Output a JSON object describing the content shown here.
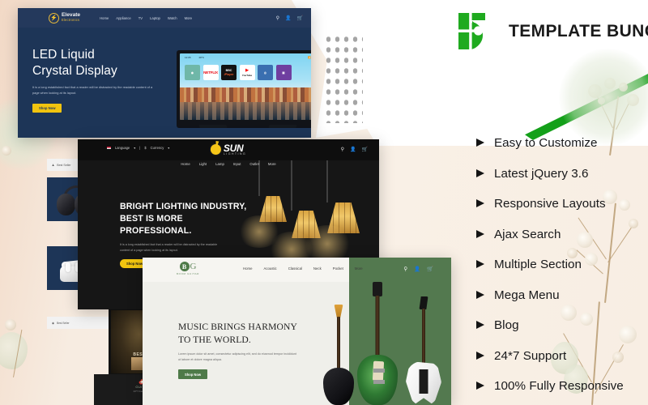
{
  "brand": {
    "name": "TEMPLATE BUNCH",
    "logo_icon": "template-bunch-b-logo",
    "accent_green": "#14a01a",
    "bg_cream": "#f7ece0"
  },
  "features": {
    "bullet_icon": "triangle-right-arrow-icon",
    "items": [
      "Easy to Customize",
      "Latest jQuery 3.6",
      "Responsive Layouts",
      "Ajax Search",
      "Multiple Section",
      "Mega Menu",
      "Blog",
      "24*7 Support",
      "100% Fully Responsive"
    ]
  },
  "mockup_electronics": {
    "logo_line1": "Elevate",
    "logo_line2": "Electronics",
    "logo_icon": "lightning-bolt-badge-icon",
    "menu": [
      "Home",
      "Appliance",
      "TV",
      "Laptop",
      "Watch",
      "More"
    ],
    "icons": [
      "search-icon",
      "account-icon",
      "cart-icon"
    ],
    "heading": "LED Liquid\nCrystal Display",
    "paragraph": "It is a long established fact that a reader will be distracted by the readable content of a page when looking at its layout.",
    "button": "Shop Now",
    "tv": {
      "weather": "28°C",
      "tiles": [
        "app",
        "NETFLIX",
        "BBC iPlayer",
        "YouTube",
        "app",
        "app"
      ]
    }
  },
  "mockup_lighting": {
    "language": "Language",
    "currency": "Currency",
    "logo_main": "SUN",
    "logo_sub": "LIGHTING",
    "logo_icon": "sun-icon",
    "menu": [
      "Home",
      "Light",
      "Lamp",
      "Input",
      "Outlet",
      "More"
    ],
    "icons": [
      "search-icon",
      "account-icon",
      "cart-icon"
    ],
    "heading_line1": "BRIGHT LIGHTING INDUSTRY,",
    "heading_line2": "BEST IS MORE PROFESSIONAL.",
    "paragraph": "It is a long established fact that a reader will be distracted by the readable content of a page when looking at its layout.",
    "button": "Shop Now"
  },
  "mockup_guitar": {
    "logo_b": "B",
    "logo_g": "G",
    "logo_sub": "BOOM GUITAR",
    "menu": [
      "Home",
      "Acoustic",
      "Classical",
      "Neck",
      "Pocket",
      "More"
    ],
    "icons": [
      "search-icon",
      "account-icon",
      "cart-icon"
    ],
    "heading_line1": "MUSIC BRINGS HARMONY",
    "heading_line2": "TO THE WORLD.",
    "paragraph": "Lorem ipsum dolor sit amet, consectetur adipiscing elit, sed do eiusmod tempor incididunt ut labore et dolore magna aliqua.",
    "button": "Shop Now"
  },
  "product_cards": {
    "chip_label": "Best Seller",
    "items": [
      "headphones-product",
      "airpods-product"
    ]
  },
  "poster": {
    "text": "BEST"
  },
  "bottom_strip": {
    "logo": "GUITAR",
    "tagline": "24*7 Free Support"
  }
}
